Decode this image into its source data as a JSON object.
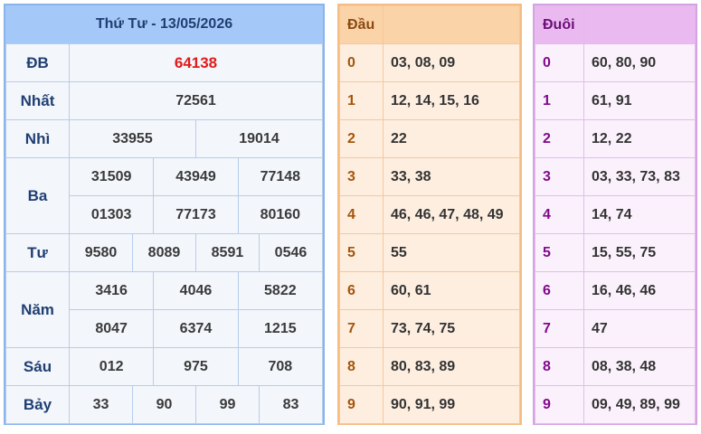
{
  "results": {
    "title": "Thứ Tư - 13/05/2026",
    "prizes": [
      {
        "label": "ĐB",
        "values": [
          "64138"
        ]
      },
      {
        "label": "Nhất",
        "values": [
          "72561"
        ]
      },
      {
        "label": "Nhì",
        "values": [
          "33955",
          "19014"
        ]
      },
      {
        "label": "Ba",
        "values": [
          "31509",
          "43949",
          "77148",
          "01303",
          "77173",
          "80160"
        ]
      },
      {
        "label": "Tư",
        "values": [
          "9580",
          "8089",
          "8591",
          "0546"
        ]
      },
      {
        "label": "Năm",
        "values": [
          "3416",
          "4046",
          "5822",
          "8047",
          "6374",
          "1215"
        ]
      },
      {
        "label": "Sáu",
        "values": [
          "012",
          "975",
          "708"
        ]
      },
      {
        "label": "Bảy",
        "values": [
          "33",
          "90",
          "99",
          "83"
        ]
      }
    ]
  },
  "dau": {
    "header": "Đầu",
    "rows": [
      {
        "k": "0",
        "v": "03, 08, 09"
      },
      {
        "k": "1",
        "v": "12, 14, 15, 16"
      },
      {
        "k": "2",
        "v": "22"
      },
      {
        "k": "3",
        "v": "33, 38"
      },
      {
        "k": "4",
        "v": "46, 46, 47, 48, 49"
      },
      {
        "k": "5",
        "v": "55"
      },
      {
        "k": "6",
        "v": "60, 61"
      },
      {
        "k": "7",
        "v": "73, 74, 75"
      },
      {
        "k": "8",
        "v": "80, 83, 89"
      },
      {
        "k": "9",
        "v": "90, 91, 99"
      }
    ]
  },
  "duoi": {
    "header": "Đuôi",
    "rows": [
      {
        "k": "0",
        "v": "60, 80, 90"
      },
      {
        "k": "1",
        "v": "61, 91"
      },
      {
        "k": "2",
        "v": "12, 22"
      },
      {
        "k": "3",
        "v": "03, 33, 73, 83"
      },
      {
        "k": "4",
        "v": "14, 74"
      },
      {
        "k": "5",
        "v": "15, 55, 75"
      },
      {
        "k": "6",
        "v": "16, 46, 46"
      },
      {
        "k": "7",
        "v": "47"
      },
      {
        "k": "8",
        "v": "08, 38, 48"
      },
      {
        "k": "9",
        "v": "09, 49, 89, 99"
      }
    ]
  }
}
